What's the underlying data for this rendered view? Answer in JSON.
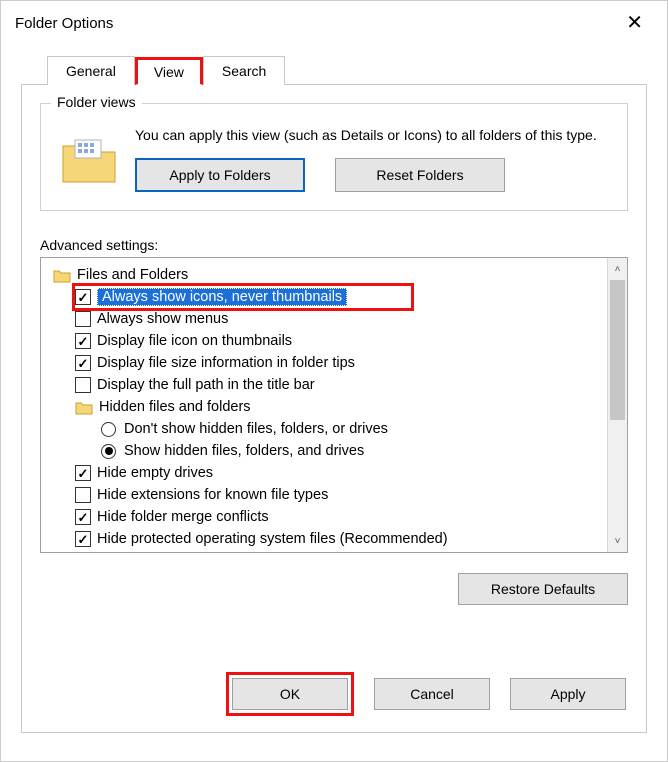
{
  "window": {
    "title": "Folder Options",
    "close_glyph": "✕"
  },
  "tabs": {
    "general": "General",
    "view": "View",
    "search": "Search",
    "active": "view"
  },
  "folder_views": {
    "legend": "Folder views",
    "description": "You can apply this view (such as Details or Icons) to all folders of this type.",
    "apply_label": "Apply to Folders",
    "reset_label": "Reset Folders"
  },
  "advanced": {
    "label": "Advanced settings:",
    "items": [
      {
        "type": "group",
        "label": "Files and Folders",
        "indent": 0
      },
      {
        "type": "check",
        "checked": true,
        "selected": true,
        "label": "Always show icons, never thumbnails",
        "indent": 1
      },
      {
        "type": "check",
        "checked": false,
        "label": "Always show menus",
        "indent": 1
      },
      {
        "type": "check",
        "checked": true,
        "label": "Display file icon on thumbnails",
        "indent": 1
      },
      {
        "type": "check",
        "checked": true,
        "label": "Display file size information in folder tips",
        "indent": 1
      },
      {
        "type": "check",
        "checked": false,
        "label": "Display the full path in the title bar",
        "indent": 1
      },
      {
        "type": "group",
        "label": "Hidden files and folders",
        "indent": 1
      },
      {
        "type": "radio",
        "checked": false,
        "label": "Don't show hidden files, folders, or drives",
        "indent": 2
      },
      {
        "type": "radio",
        "checked": true,
        "label": "Show hidden files, folders, and drives",
        "indent": 2
      },
      {
        "type": "check",
        "checked": true,
        "label": "Hide empty drives",
        "indent": 1
      },
      {
        "type": "check",
        "checked": false,
        "label": "Hide extensions for known file types",
        "indent": 1
      },
      {
        "type": "check",
        "checked": true,
        "label": "Hide folder merge conflicts",
        "indent": 1
      },
      {
        "type": "check",
        "checked": true,
        "label": "Hide protected operating system files (Recommended)",
        "indent": 1
      }
    ]
  },
  "buttons": {
    "restore_defaults": "Restore Defaults",
    "ok": "OK",
    "cancel": "Cancel",
    "apply": "Apply"
  },
  "scroll_glyphs": {
    "up": "˄",
    "down": "˅"
  }
}
